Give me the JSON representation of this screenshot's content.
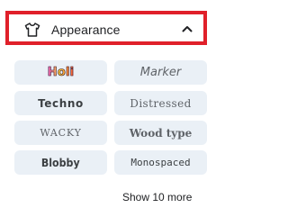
{
  "section": {
    "title": "Appearance",
    "icon": "tshirt-icon",
    "expanded_icon": "chevron-up-icon",
    "highlight_color": "#e0202a"
  },
  "fonts": [
    {
      "label": "Holi"
    },
    {
      "label": "Marker"
    },
    {
      "label": "Techno"
    },
    {
      "label": "Distressed"
    },
    {
      "label": "WACKY"
    },
    {
      "label": "Wood type"
    },
    {
      "label": "Blobby"
    },
    {
      "label": "Monospaced"
    }
  ],
  "chip_color": "#eaf0f6",
  "show_more": {
    "label": "Show 10 more"
  }
}
